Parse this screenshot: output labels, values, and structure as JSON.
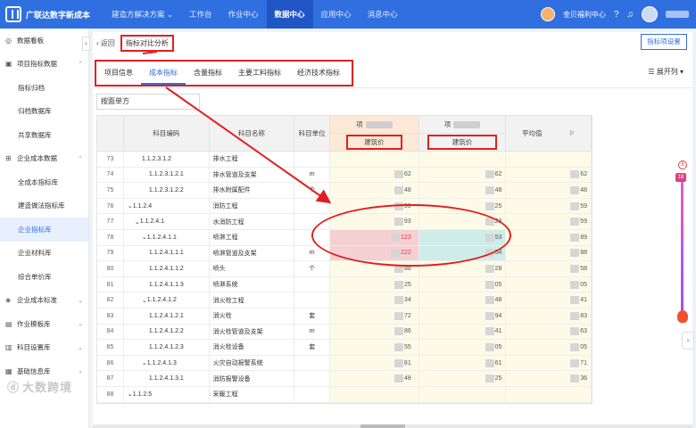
{
  "app": {
    "brand": "广联达数字新成本",
    "nav": [
      {
        "label": "建造方解决方案",
        "has_dropdown": true
      },
      {
        "label": "工作台"
      },
      {
        "label": "作业中心"
      },
      {
        "label": "数据中心",
        "active": true
      },
      {
        "label": "应用中心"
      },
      {
        "label": "消息中心"
      }
    ],
    "company": "金贝福利中心"
  },
  "sidebar": {
    "items": [
      {
        "icon": "dashboard-icon",
        "label": "数据看板",
        "level": 0
      },
      {
        "icon": "folder-icon",
        "label": "项目指标数据",
        "level": 0,
        "arrow": "⌃"
      },
      {
        "label": "指标归档",
        "level": 1
      },
      {
        "label": "归档数据库",
        "level": 1
      },
      {
        "label": "共享数据库",
        "level": 1
      },
      {
        "icon": "enterprise-icon",
        "label": "企业成本数据",
        "level": 0,
        "arrow": "⌃"
      },
      {
        "label": "全成本指标库",
        "level": 1
      },
      {
        "label": "建造做法指标库",
        "level": 1
      },
      {
        "label": "企业指标库",
        "level": 1,
        "active": true
      },
      {
        "label": "企业材料库",
        "level": 1
      },
      {
        "label": "综合单价库",
        "level": 1
      },
      {
        "icon": "standard-icon",
        "label": "企业成本标准",
        "level": 0,
        "arrow": "⌄"
      },
      {
        "icon": "template-icon",
        "label": "作业模板库",
        "level": 0,
        "arrow": "⌄"
      },
      {
        "icon": "knowledge-icon",
        "label": "科目设置库",
        "level": 0,
        "arrow": "⌄"
      },
      {
        "icon": "base-icon",
        "label": "基础信息库",
        "level": 0,
        "arrow": "⌄"
      }
    ],
    "watermark": "大数跨境"
  },
  "main": {
    "back": "返回",
    "current": "指标对比分析",
    "top_button": "指标项设置",
    "tabs": [
      {
        "label": "项目信息"
      },
      {
        "label": "成本指标",
        "active": true
      },
      {
        "label": "含量指标"
      },
      {
        "label": "主要工料指标"
      },
      {
        "label": "经济技术指标"
      }
    ],
    "expand_label": "展开列",
    "select_value": "按面单方"
  },
  "table": {
    "headers": {
      "idx": "",
      "code": "科目编码",
      "name": "科目名称",
      "unit": "科目单位",
      "project_a_prefix": "项",
      "project_b_prefix": "项",
      "col_a_sub": "建筑价",
      "col_b_sub": "建筑价",
      "avg": "平均值"
    },
    "rows": [
      {
        "idx": "73",
        "code": "1.1.2.3.1.2",
        "indent": 2,
        "name": "排水工程",
        "unit": "",
        "v1": "",
        "v2": "",
        "avg": ""
      },
      {
        "idx": "74",
        "code": "1.1.2.3.1.2.1",
        "indent": 3,
        "name": "排水管道及支架",
        "unit": "m",
        "v1": "62",
        "v2": "62",
        "avg": "62"
      },
      {
        "idx": "75",
        "code": "1.1.2.3.1.2.2",
        "indent": 3,
        "name": "排水附属配件",
        "unit": "个",
        "v1": "48",
        "v2": "48",
        "avg": "48"
      },
      {
        "idx": "76",
        "code": "1.1.2.4",
        "indent": 0,
        "toggle": "⌄",
        "name": "消防工程",
        "unit": "",
        "v1": "93",
        "v2": "25",
        "avg": "59"
      },
      {
        "idx": "77",
        "code": "1.1.2.4.1",
        "indent": 1,
        "toggle": "⌄",
        "name": "水消防工程",
        "unit": "",
        "v1": "93",
        "v2": "23",
        "avg": "59"
      },
      {
        "idx": "78",
        "code": "1.1.2.4.1.1",
        "indent": 2,
        "toggle": "⌄",
        "name": "喷淋工程",
        "unit": "",
        "v1": "123",
        "v2": "53",
        "avg": "89",
        "highlight": true
      },
      {
        "idx": "79",
        "code": "1.1.2.4.1.1.1",
        "indent": 3,
        "name": "喷淋管道及支架",
        "unit": "m",
        "v1": "222",
        "v2": "54",
        "avg": "88",
        "highlight": true
      },
      {
        "idx": "80",
        "code": "1.1.2.4.1.1.2",
        "indent": 3,
        "name": "喷头",
        "unit": "个",
        "v1": "88",
        "v2": "28",
        "avg": "58"
      },
      {
        "idx": "81",
        "code": "1.1.2.4.1.1.3",
        "indent": 3,
        "name": "喷淋系统",
        "unit": "",
        "v1": "25",
        "v2": "05",
        "avg": "05"
      },
      {
        "idx": "82",
        "code": "1.1.2.4.1.2",
        "indent": 2,
        "toggle": "⌄",
        "name": "消火栓工程",
        "unit": "",
        "v1": "34",
        "v2": "48",
        "avg": "41"
      },
      {
        "idx": "83",
        "code": "1.1.2.4.1.2.1",
        "indent": 3,
        "name": "消火栓",
        "unit": "套",
        "v1": "72",
        "v2": "94",
        "avg": "83"
      },
      {
        "idx": "84",
        "code": "1.1.2.4.1.2.2",
        "indent": 3,
        "name": "消火栓管道及支架",
        "unit": "m",
        "v1": "86",
        "v2": "41",
        "avg": "63"
      },
      {
        "idx": "85",
        "code": "1.1.2.4.1.2.3",
        "indent": 3,
        "name": "消火栓设备",
        "unit": "套",
        "v1": "55",
        "v2": "05",
        "avg": "05"
      },
      {
        "idx": "86",
        "code": "1.1.2.4.1.3",
        "indent": 2,
        "toggle": "⌄",
        "name": "火灾自动报警系统",
        "unit": "",
        "v1": "81",
        "v2": "61",
        "avg": "71"
      },
      {
        "idx": "87",
        "code": "1.1.2.4.1.3.1",
        "indent": 3,
        "name": "消防报警设备",
        "unit": "",
        "v1": "48",
        "v2": "25",
        "avg": "36"
      },
      {
        "idx": "88",
        "code": "1.1.2.5",
        "indent": 0,
        "toggle": "⌄",
        "name": "采暖工程",
        "unit": "",
        "v1": "",
        "v2": "",
        "avg": ""
      }
    ]
  },
  "rail": {
    "top_badge": "8",
    "knob": "18"
  },
  "colors": {
    "primary": "#2f6fe0",
    "annotation_red": "#e02020"
  }
}
